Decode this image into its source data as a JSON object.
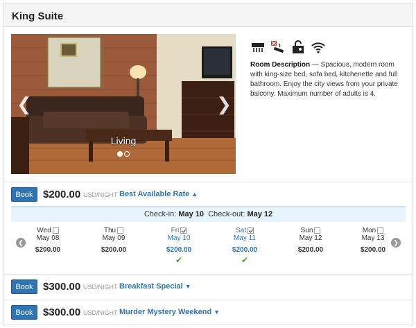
{
  "room": {
    "title": "King Suite",
    "photo_caption": "Living",
    "description_label": "Room Description",
    "description_text": " — Spacious, modern room with king-size bed, sofa bed, kitchenette and full bathroom. Enjoy the city views from your private balcony. Maximum number of adults is 4.",
    "amenity_icons": [
      "heater-icon",
      "no-smoking-icon",
      "safe-icon",
      "wifi-icon"
    ]
  },
  "rates": [
    {
      "book_label": "Book",
      "price": "$200.00",
      "unit": "USD/NIGHT",
      "name": "Best Available Rate",
      "expanded": true
    },
    {
      "book_label": "Book",
      "price": "$300.00",
      "unit": "USD/NIGHT",
      "name": "Breakfast Special",
      "expanded": false
    },
    {
      "book_label": "Book",
      "price": "$300.00",
      "unit": "USD/NIGHT",
      "name": "Murder Mystery Weekend",
      "expanded": false
    }
  ],
  "stay": {
    "checkin_label": "Check-in:",
    "checkin_date": "May 10",
    "checkout_label": "Check-out:",
    "checkout_date": "May 12"
  },
  "days": [
    {
      "dow": "Wed",
      "date": "May 08",
      "price": "$200.00",
      "checked": false
    },
    {
      "dow": "Thu",
      "date": "May 09",
      "price": "$200.00",
      "checked": false
    },
    {
      "dow": "Fri",
      "date": "May 10",
      "price": "$200.00",
      "checked": true
    },
    {
      "dow": "Sat",
      "date": "May 11",
      "price": "$200.00",
      "checked": true
    },
    {
      "dow": "Sun",
      "date": "May 12",
      "price": "$200.00",
      "checked": false
    },
    {
      "dow": "Mon",
      "date": "May 13",
      "price": "$200.00",
      "checked": false
    }
  ],
  "colors": {
    "accent": "#2e74b5",
    "check_green": "#4aa02c",
    "checkbar_bg": "#e8f4fb"
  }
}
